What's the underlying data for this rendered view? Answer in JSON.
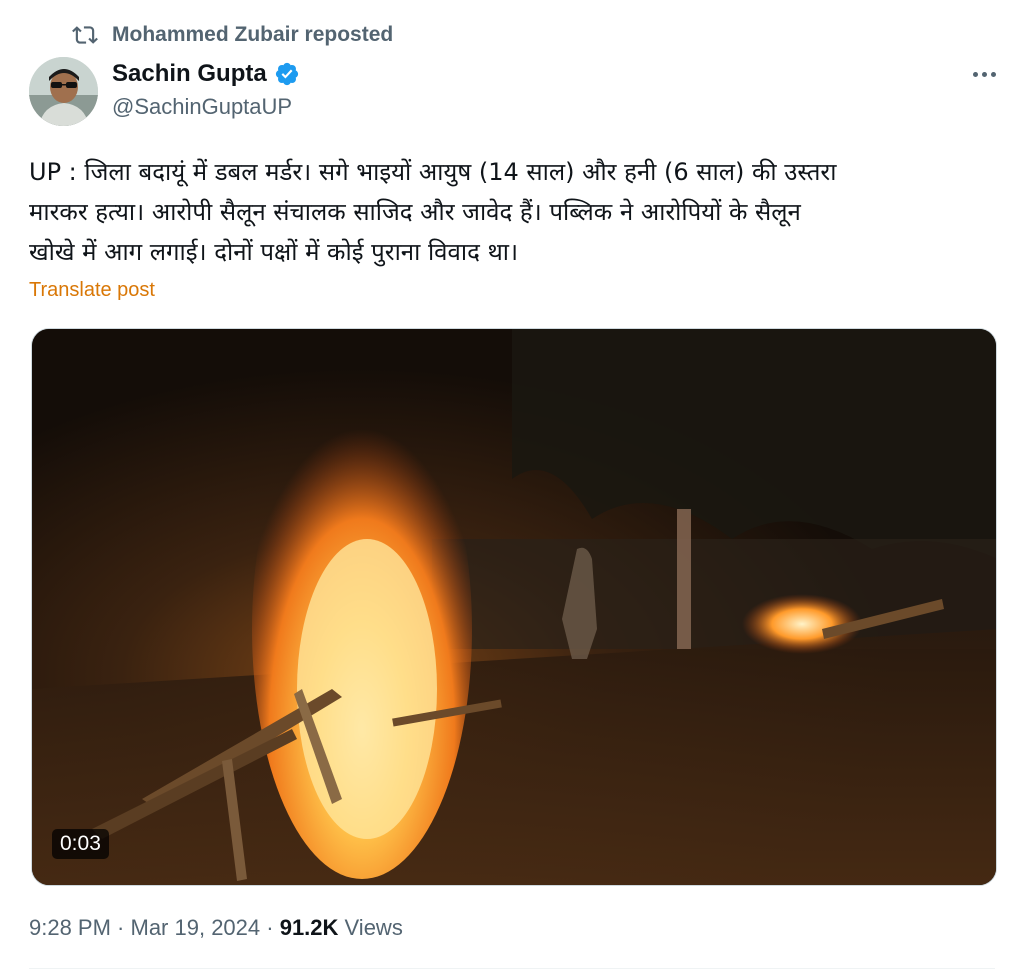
{
  "repost": {
    "text": "Mohammed Zubair reposted",
    "icon": "repost-icon"
  },
  "author": {
    "name": "Sachin Gupta",
    "handle": "@SachinGuptaUP",
    "verified": true,
    "verified_color": "#1d9bf0"
  },
  "post": {
    "lines": [
      "UP : जिला बदायूं में डबल मर्डर। सगे भाइयों आयुष (14 साल) और हनी (6 साल) की उस्तरा",
      "मारकर हत्या। आरोपी सैलून संचालक साजिद और जावेद हैं। पब्लिक ने आरोपियों के सैलून",
      "खोखे में आग लगाई। दोनों पक्षों में कोई पुराना विवाद था।"
    ],
    "translate_label": "Translate post"
  },
  "media": {
    "duration": "0:03",
    "type": "video"
  },
  "meta": {
    "time": "9:28 PM",
    "separator": " · ",
    "date": "Mar 19, 2024",
    "views_count": "91.2K",
    "views_label": " Views"
  },
  "colors": {
    "accent": "#1d9bf0",
    "translate": "#d97706",
    "secondary_text": "#536471"
  }
}
